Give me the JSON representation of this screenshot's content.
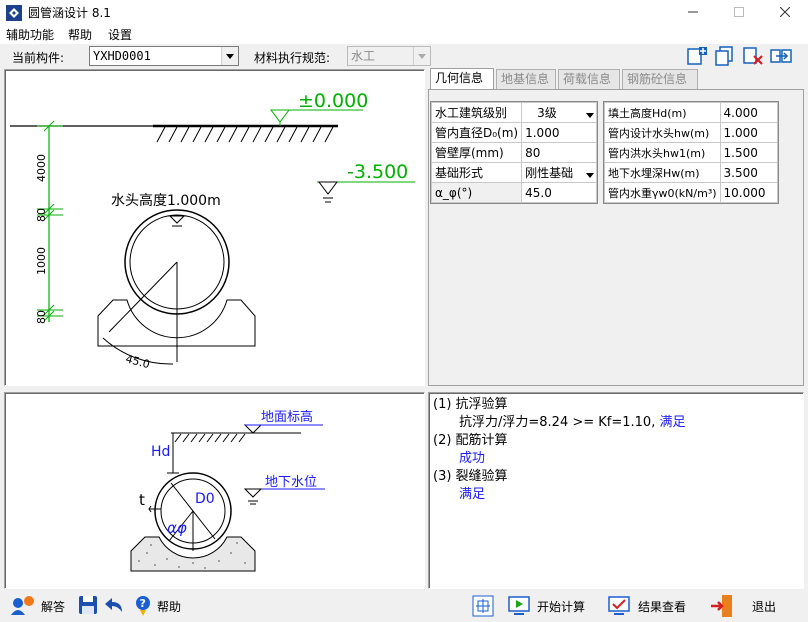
{
  "window": {
    "title": "圆管涵设计 8.1"
  },
  "menu": {
    "items": [
      "辅助功能",
      "帮助",
      "设置"
    ]
  },
  "toolbar": {
    "component_label": "当前构件:",
    "component_value": "YXHD0001",
    "spec_label": "材料执行规范:",
    "spec_value": "水工"
  },
  "drawing": {
    "elev_top": "±0.000",
    "elev_water": "-3.500",
    "head_label": "水头高度1.000m",
    "dims": [
      "4000",
      "80",
      "1000",
      "80"
    ],
    "angle": "45.0"
  },
  "tabs": [
    "几何信息",
    "地基信息",
    "荷载信息",
    "钢筋砼信息"
  ],
  "geometry_left": [
    {
      "label": "水工建筑级别",
      "value": "3级",
      "dropdown": true
    },
    {
      "label": "管内直径D₀(m)",
      "value": "1.000"
    },
    {
      "label": "管壁厚(mm)",
      "value": "80"
    },
    {
      "label": "基础形式",
      "value": "刚性基础",
      "dropdown": true
    },
    {
      "label": "α_φ(°)",
      "value": "45.0"
    }
  ],
  "geometry_right": [
    {
      "label": "填土高度Hd(m)",
      "value": "4.000"
    },
    {
      "label": "管内设计水头hw(m)",
      "value": "1.000"
    },
    {
      "label": "管内洪水头hw1(m)",
      "value": "1.500"
    },
    {
      "label": "地下水埋深Hw(m)",
      "value": "3.500"
    },
    {
      "label": "管内水重γw0(kN/m³)",
      "value": "10.000"
    }
  ],
  "schematic": {
    "ground": "地面标高",
    "groundwater": "地下水位",
    "hd": "Hd",
    "d0": "D0",
    "t": "t",
    "alpha": "αφ"
  },
  "results": {
    "s1_title": "(1) 抗浮验算",
    "s1_detail": "抗浮力/浮力=8.24 >= Kf=1.10,",
    "s1_status": "满足",
    "s2_title": "(2) 配筋计算",
    "s2_status": "成功",
    "s3_title": "(3) 裂缝验算",
    "s3_status": "满足"
  },
  "bottom": {
    "answer": "解答",
    "help": "帮助",
    "calc": "开始计算",
    "view": "结果查看",
    "exit": "退出"
  },
  "colors": {
    "drawing_green": "#00b000",
    "result_blue": "#1a1aff",
    "schematic_blue": "#1a1aff"
  }
}
